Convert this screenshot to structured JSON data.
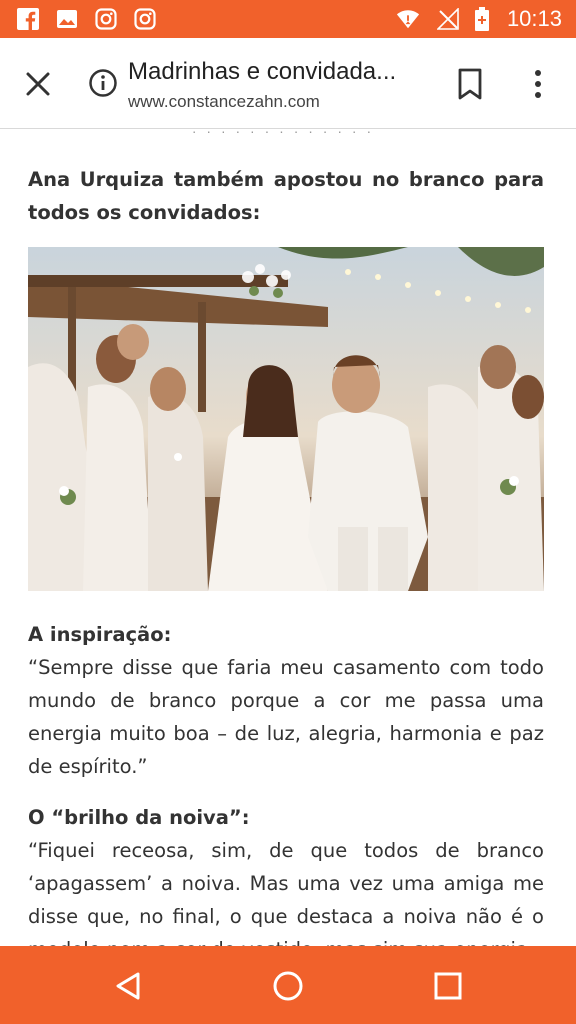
{
  "status_bar": {
    "time": "10:13",
    "left_icons": [
      "facebook-icon",
      "gallery-icon",
      "instagram-icon",
      "instagram-icon"
    ],
    "right_icons": [
      "wifi-icon",
      "no-signal-icon",
      "battery-icon"
    ]
  },
  "toolbar": {
    "title": "Madrinhas e convidada...",
    "url": "www.constancezahn.com"
  },
  "content": {
    "dots": "· · · · · · · · · · · · ·",
    "intro": "Ana Urquiza também apostou no branco para todos os convidados:",
    "photo_icon": "wedding-photo",
    "section1_heading": "A inspiração:",
    "section1_text": "“Sempre disse que faria meu casamento com todo mundo de branco porque a cor me passa uma energia muito boa – de luz, alegria, harmonia e paz de espírito.”",
    "section2_heading": "O “brilho da noiva”:",
    "section2_text": "“Fiquei receosa, sim, de que todos de branco ‘apagassem’ a noiva. Mas uma vez uma amiga me disse que, no final, o que destaca a noiva não é o modelo nem a cor do vestido, mas sim sua energia"
  },
  "colors": {
    "accent": "#f1612b",
    "text": "#333333"
  },
  "nav_bar": {
    "icons": [
      "back-icon",
      "home-icon",
      "recents-icon"
    ]
  }
}
